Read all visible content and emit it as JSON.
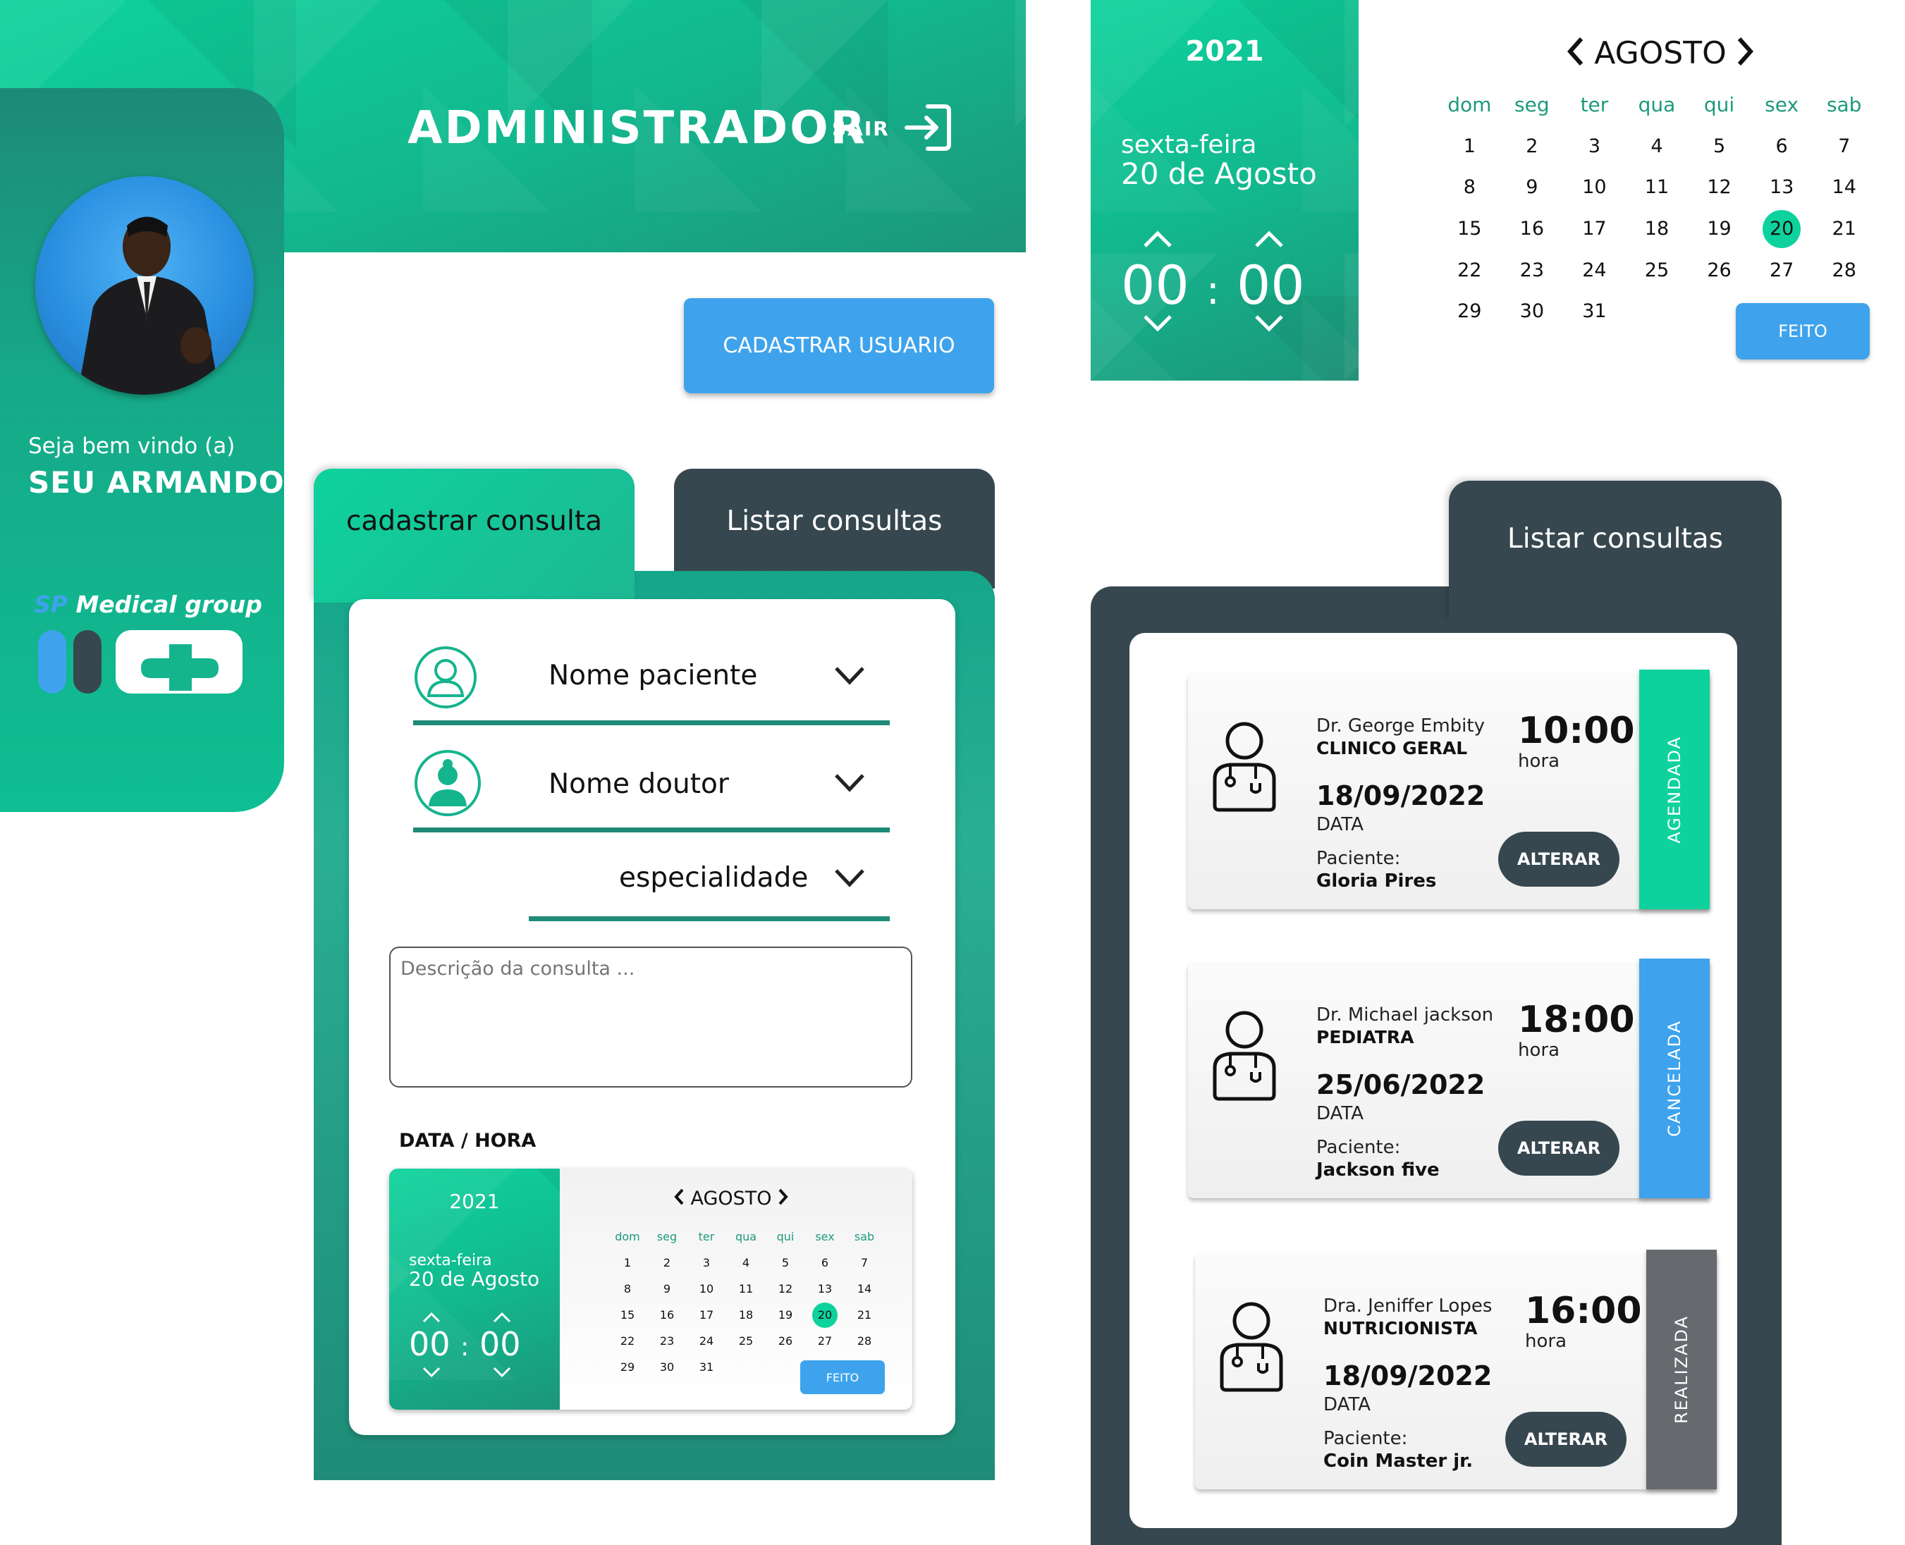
{
  "header": {
    "title": "ADMINISTRADOR",
    "logout_label": "SAIR"
  },
  "sidebar": {
    "welcome": "Seja bem vindo (a)",
    "user_name": "SEU ARMANDO",
    "brand_prefix": "SP",
    "brand_name": "Medical group"
  },
  "actions": {
    "register_user": "CADASTRAR USUARIO"
  },
  "tabs": {
    "register": "cadastrar consulta",
    "list": "Listar consultas"
  },
  "form": {
    "patient": "Nome paciente",
    "doctor": "Nome doutor",
    "specialty": "especialidade",
    "description_placeholder": "Descrição da consulta ...",
    "datetime_label": "DATA / HORA"
  },
  "datepicker": {
    "year": "2021",
    "weekday": "sexta-feira",
    "date": "20 de Agosto",
    "hour": "00",
    "separator": ":",
    "minute": "00",
    "month": "AGOSTO",
    "weekdays": [
      "dom",
      "seg",
      "ter",
      "qua",
      "qui",
      "sex",
      "sab"
    ],
    "days": [
      [
        "1",
        "2",
        "3",
        "4",
        "5",
        "6",
        "7"
      ],
      [
        "8",
        "9",
        "10",
        "11",
        "12",
        "13",
        "14"
      ],
      [
        "15",
        "16",
        "17",
        "18",
        "19",
        "20",
        "21"
      ],
      [
        "22",
        "23",
        "24",
        "25",
        "26",
        "27",
        "28"
      ],
      [
        "29",
        "30",
        "31",
        "",
        "",
        "",
        ""
      ]
    ],
    "selected_day": "20",
    "done": "FEITO",
    "accent": "#0ed29d"
  },
  "appointments": [
    {
      "doctor": "Dr. George Embity",
      "specialty": "CLINICO GERAL",
      "time": "10:00",
      "time_label": "hora",
      "date": "18/09/2022",
      "date_label": "DATA",
      "patient_label": "Paciente:",
      "patient": "Gloria Pires",
      "action": "ALTERAR",
      "status": "AGENDADA",
      "status_color": "#0ed29d"
    },
    {
      "doctor": "Dr. Michael jackson",
      "specialty": "PEDIATRA",
      "time": "18:00",
      "time_label": "hora",
      "date": "25/06/2022",
      "date_label": "DATA",
      "patient_label": "Paciente:",
      "patient": "Jackson five",
      "action": "ALTERAR",
      "status": "CANCELADA",
      "status_color": "#3ea3ec"
    },
    {
      "doctor": "Dra. Jeniffer Lopes",
      "specialty": "NUTRICIONISTA",
      "time": "16:00",
      "time_label": "hora",
      "date": "18/09/2022",
      "date_label": "DATA",
      "patient_label": "Paciente:",
      "patient": "Coin Master jr.",
      "action": "ALTERAR",
      "status": "REALIZADA",
      "status_color": "#666a6e"
    }
  ]
}
